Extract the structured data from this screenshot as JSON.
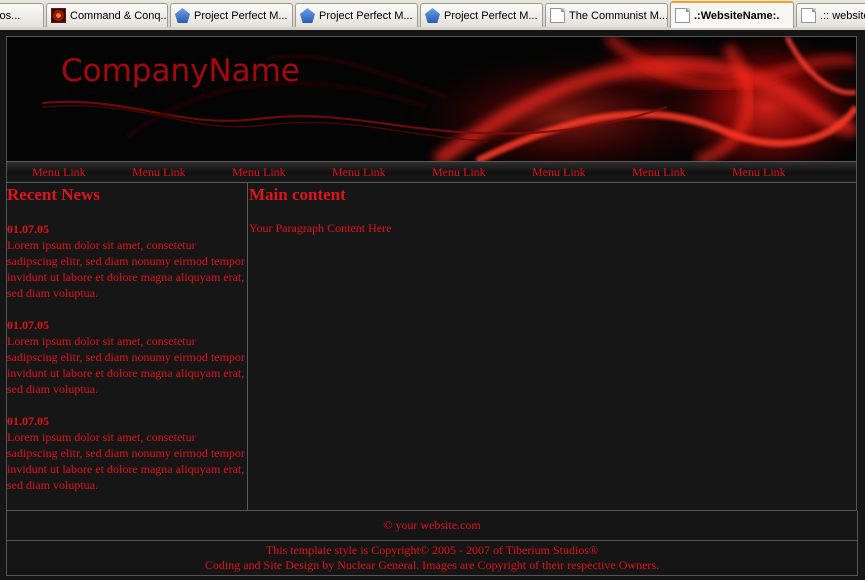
{
  "browser": {
    "tabs": [
      {
        "label": "dios...",
        "icon": "none",
        "active": false
      },
      {
        "label": "Command & Conq...",
        "icon": "cnc-icon",
        "active": false
      },
      {
        "label": "Project Perfect M...",
        "icon": "ppm-icon",
        "active": false
      },
      {
        "label": "Project Perfect M...",
        "icon": "ppm-icon",
        "active": false
      },
      {
        "label": "Project Perfect M...",
        "icon": "ppm-icon",
        "active": false
      },
      {
        "label": "The Communist M...",
        "icon": "page-icon",
        "active": false
      },
      {
        "label": ".:WebsiteName:.",
        "icon": "page-icon",
        "active": true
      },
      {
        "label": ".:: website",
        "icon": "page-icon",
        "active": false
      }
    ]
  },
  "header": {
    "company_name": "CompanyName"
  },
  "menu": {
    "links": [
      "Menu Link",
      "Menu Link",
      "Menu Link",
      "Menu Link",
      "Menu Link",
      "Menu Link",
      "Menu Link",
      "Menu Link"
    ]
  },
  "sidebar": {
    "title": "Recent News",
    "news": [
      {
        "date": "01.07.05",
        "text": "Lorem ipsum dolor sit amet, consetetur sadipscing elitr, sed diam nonumy eirmod tempor invidunt ut labore et dolore magna aliquyam erat, sed diam voluptua."
      },
      {
        "date": "01.07.05",
        "text": "Lorem ipsum dolor sit amet, consetetur sadipscing elitr, sed diam nonumy eirmod tempor invidunt ut labore et dolore magna aliquyam erat, sed diam voluptua."
      },
      {
        "date": "01.07.05",
        "text": "Lorem ipsum dolor sit amet, consetetur sadipscing elitr, sed diam nonumy eirmod tempor invidunt ut labore et dolore magna aliquyam erat, sed diam voluptua."
      }
    ]
  },
  "main": {
    "title": "Main content",
    "paragraph": "Your Paragraph Content Here"
  },
  "footer": {
    "site": "© your website.com",
    "copyright_line1": "This template style is Copyright© 2005 - 2007 of Tiberium Studios®",
    "copyright_line2": "Coding and Site Design by Nuclear General. Images are Copyright of their respective Owners."
  },
  "colors": {
    "accent": "#e0141c",
    "background": "#161616",
    "header_bg": "#040404"
  }
}
